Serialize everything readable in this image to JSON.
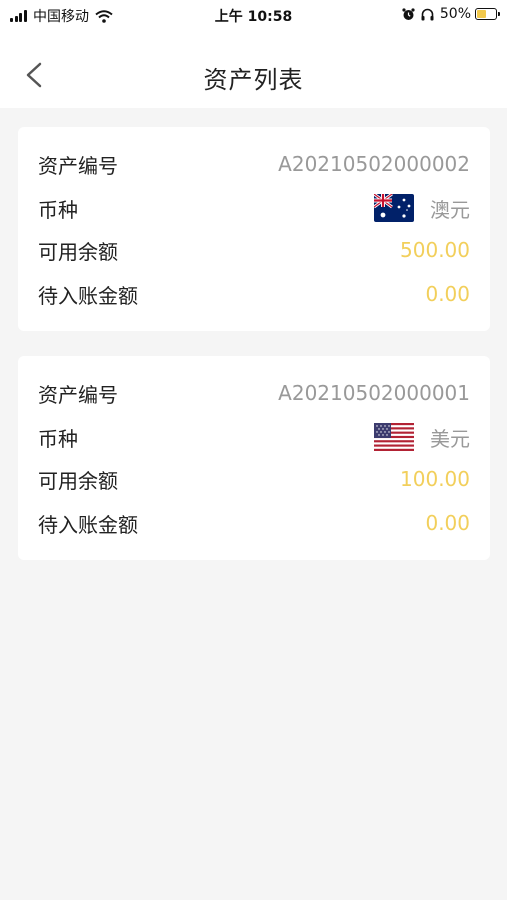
{
  "status_bar": {
    "carrier": "中国移动",
    "time": "上午 10:58",
    "battery_percent": "50%",
    "battery_level": 0.5
  },
  "nav": {
    "title": "资产列表",
    "back_icon": "chevron-left-icon"
  },
  "colors": {
    "accent_value": "#f2cf5b",
    "muted_value": "#999999",
    "page_background": "#f5f5f5"
  },
  "assets": [
    {
      "id_label": "资产编号",
      "id_value": "A20210502000002",
      "currency_label": "币种",
      "currency_value": "澳元",
      "flag_icon": "australia-flag-icon",
      "available_label": "可用余额",
      "available_value": "500.00",
      "pending_label": "待入账金额",
      "pending_value": "0.00"
    },
    {
      "id_label": "资产编号",
      "id_value": "A20210502000001",
      "currency_label": "币种",
      "currency_value": "美元",
      "flag_icon": "usa-flag-icon",
      "available_label": "可用余额",
      "available_value": "100.00",
      "pending_label": "待入账金额",
      "pending_value": "0.00"
    }
  ]
}
